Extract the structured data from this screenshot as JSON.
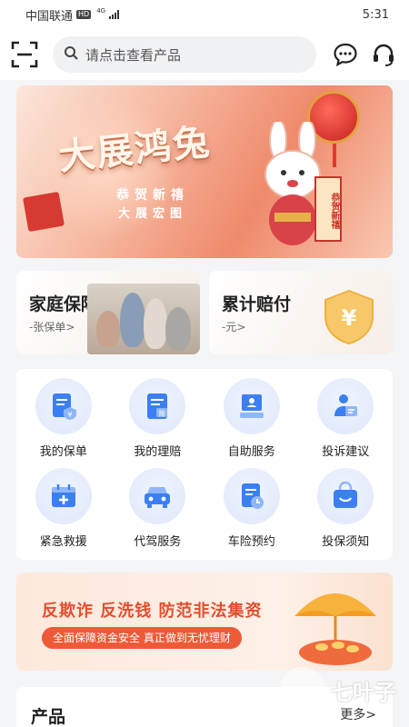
{
  "status_bar": {
    "carrier": "中国联通",
    "hd": "HD",
    "network": "4G",
    "time": "5:31"
  },
  "header": {
    "search_placeholder": "请点击查看产品",
    "icons": [
      "scan-icon",
      "message-icon",
      "headset-icon"
    ]
  },
  "banner": {
    "title": "大展鸿兔",
    "sub_line_1": "恭贺新禧",
    "sub_line_2": "大展宏图",
    "scroll_text": "恭贺新禧"
  },
  "summary_cards": [
    {
      "title": "家庭保障",
      "sub_prefix": "-",
      "sub_text": "张保单>"
    },
    {
      "title": "累计赔付",
      "sub_prefix": "-",
      "sub_text": "元>"
    }
  ],
  "services": [
    {
      "label": "我的保单",
      "icon": "policy-icon"
    },
    {
      "label": "我的理赔",
      "icon": "claim-icon"
    },
    {
      "label": "自助服务",
      "icon": "self-service-icon"
    },
    {
      "label": "投诉建议",
      "icon": "complaint-icon"
    },
    {
      "label": "紧急救援",
      "icon": "rescue-icon"
    },
    {
      "label": "代驾服务",
      "icon": "car-icon"
    },
    {
      "label": "车险预约",
      "icon": "appointment-icon"
    },
    {
      "label": "投保须知",
      "icon": "notice-bag-icon"
    }
  ],
  "promo": {
    "title": "反欺诈 反洗钱 防范非法集资",
    "pill": "全面保障资金安全 真正做到无忧理财"
  },
  "products": {
    "heading": "产品",
    "more": "更多>"
  },
  "watermark": {
    "text": "七叶子"
  },
  "colors": {
    "accent_blue": "#3b7ff3",
    "promo_red": "#e74c2c",
    "background": "#f4f5f7"
  }
}
